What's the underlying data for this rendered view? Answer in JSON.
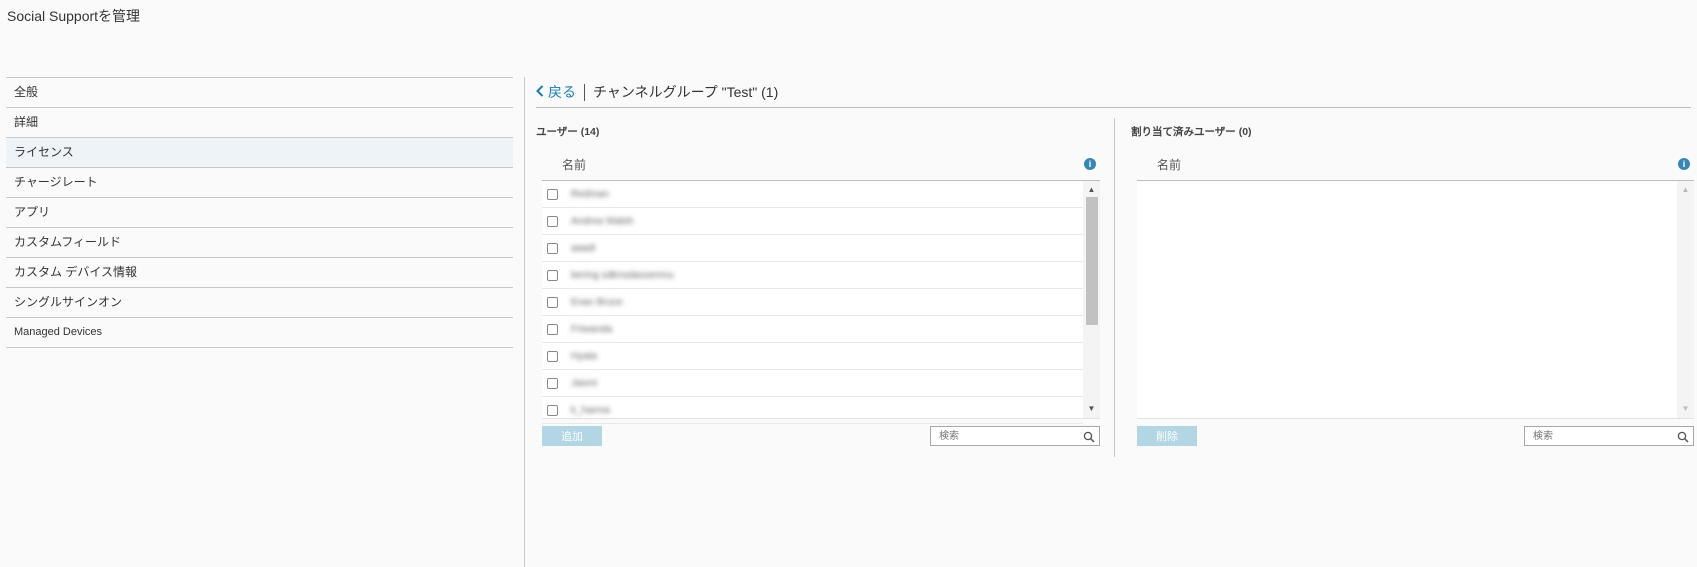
{
  "page": {
    "title": "Social Supportを管理"
  },
  "sidebar": {
    "items": [
      {
        "label": "全般"
      },
      {
        "label": "詳細"
      },
      {
        "label": "ライセンス"
      },
      {
        "label": "チャージレート"
      },
      {
        "label": "アプリ"
      },
      {
        "label": "カスタムフィールド"
      },
      {
        "label": "カスタム デバイス情報"
      },
      {
        "label": "シングルサインオン"
      },
      {
        "label": "Managed Devices"
      }
    ]
  },
  "header": {
    "back_label": "戻る",
    "title": "チャンネルグループ \"Test\" (1)"
  },
  "users_panel": {
    "title": "ユーザー (14)",
    "column_name": "名前",
    "rows": [
      {
        "name": "Redman"
      },
      {
        "name": "Andrea Walsh"
      },
      {
        "name": "aaadi"
      },
      {
        "name": "bering sdknsdassemnu"
      },
      {
        "name": "Evan Bruce"
      },
      {
        "name": "Friwanda"
      },
      {
        "name": "Hyata"
      },
      {
        "name": "Jasmi"
      },
      {
        "name": "k_harma"
      }
    ],
    "add_label": "追加",
    "search_placeholder": "検索"
  },
  "assigned_panel": {
    "title": "割り当て済みユーザー (0)",
    "column_name": "名前",
    "delete_label": "削除",
    "search_placeholder": "検索"
  },
  "colors": {
    "accent": "#1a7bb9",
    "button_disabled": "#b3d6e4",
    "info": "#3a86b3"
  }
}
